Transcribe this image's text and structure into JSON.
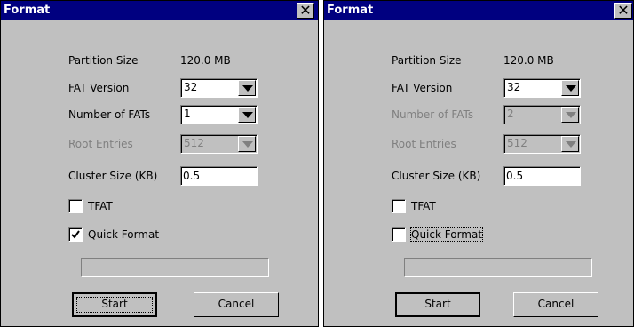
{
  "dialogs": [
    {
      "title": "Format",
      "partition_size_label": "Partition Size",
      "partition_size_value": "120.0 MB",
      "fat_version_label": "FAT Version",
      "fat_version_value": "32",
      "fats_label": "Number of FATs",
      "fats_value": "1",
      "fats_enabled": true,
      "root_entries_label": "Root Entries",
      "root_entries_value": "512",
      "root_entries_enabled": false,
      "cluster_size_label": "Cluster Size (KB)",
      "cluster_size_value": "0.5",
      "tfat_label": "TFAT",
      "tfat_checked": false,
      "quick_format_label": "Quick Format",
      "quick_format_checked": true,
      "start_label": "Start",
      "cancel_label": "Cancel"
    },
    {
      "title": "Format",
      "partition_size_label": "Partition Size",
      "partition_size_value": "120.0 MB",
      "fat_version_label": "FAT Version",
      "fat_version_value": "32",
      "fats_label": "Number of FATs",
      "fats_value": "2",
      "fats_enabled": false,
      "root_entries_label": "Root Entries",
      "root_entries_value": "512",
      "root_entries_enabled": false,
      "cluster_size_label": "Cluster Size (KB)",
      "cluster_size_value": "0.5",
      "tfat_label": "TFAT",
      "tfat_checked": false,
      "quick_format_label": "Quick Format",
      "quick_format_checked": false,
      "start_label": "Start",
      "cancel_label": "Cancel"
    }
  ],
  "colors": {
    "title_bar": "#000080",
    "dialog_bg": "#c0c0c0",
    "disabled_text": "#808080"
  }
}
